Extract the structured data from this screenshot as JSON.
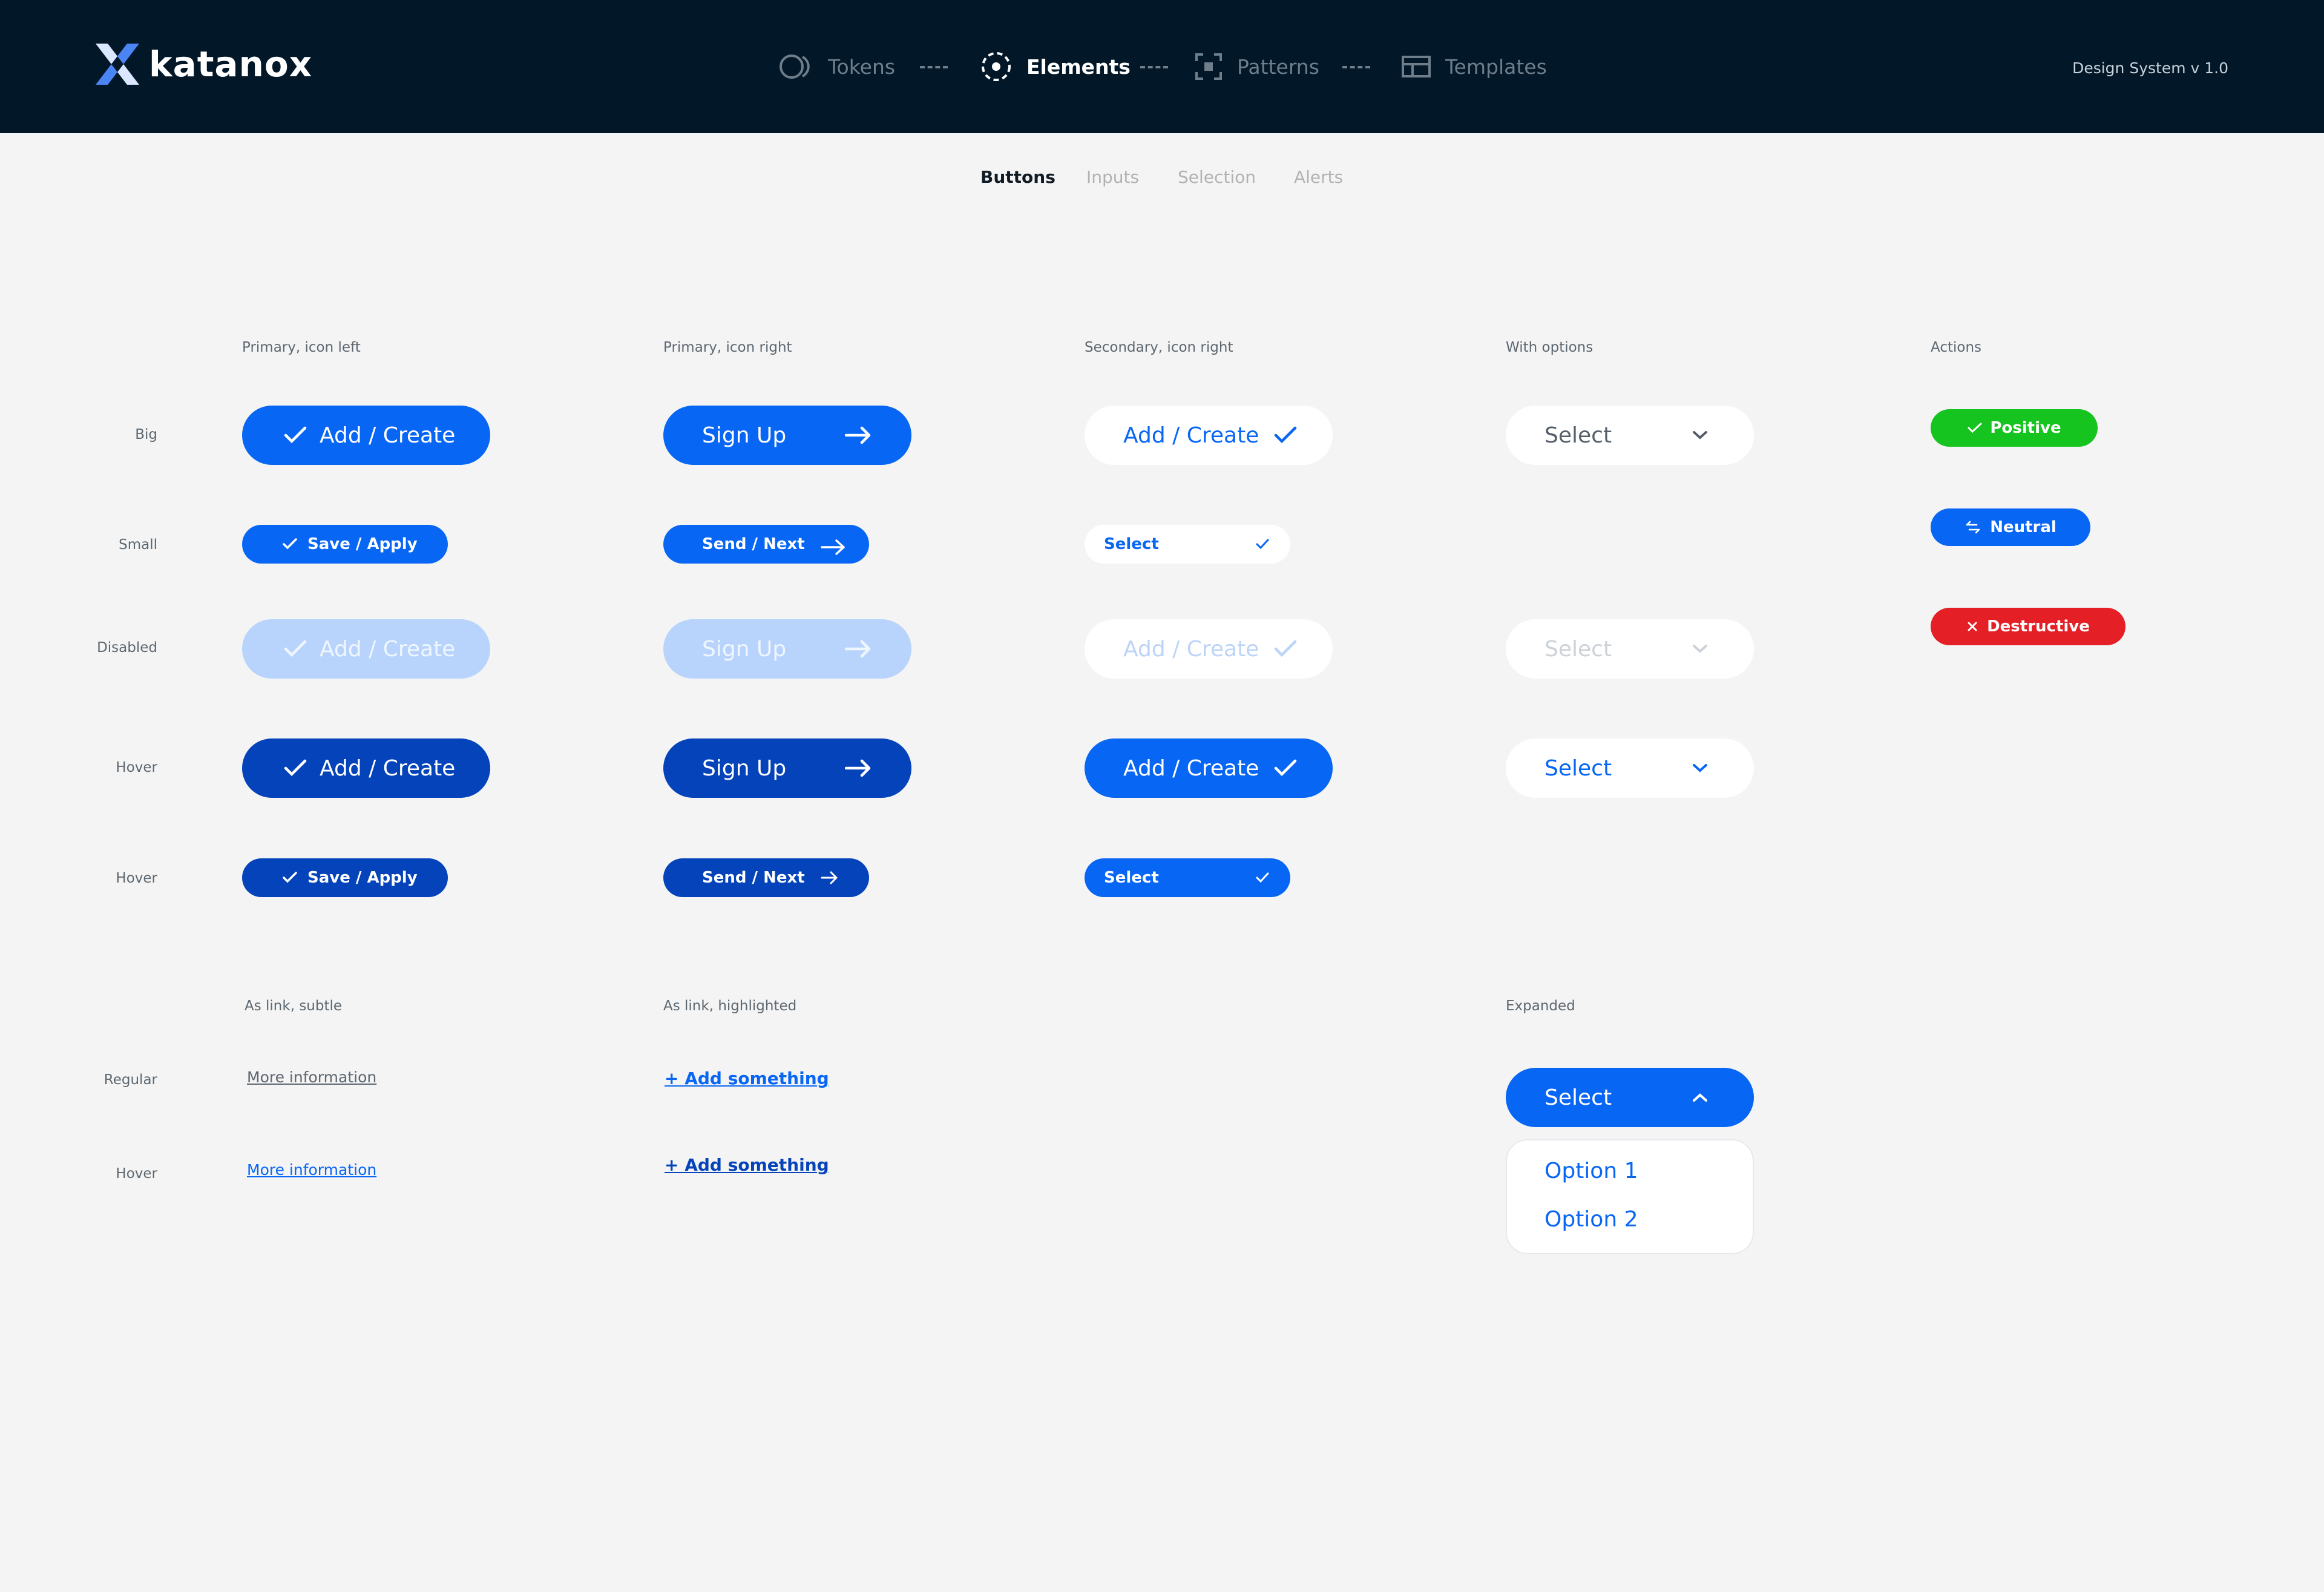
{
  "header": {
    "brand": "katanox",
    "version": "Design System v 1.0",
    "nav": [
      {
        "label": "Tokens"
      },
      {
        "label": "Elements"
      },
      {
        "label": "Patterns"
      },
      {
        "label": "Templates"
      }
    ]
  },
  "subnav": [
    "Buttons",
    "Inputs",
    "Selection",
    "Alerts"
  ],
  "columns": {
    "c1": "Primary, icon left",
    "c2": "Primary, icon right",
    "c3": "Secondary, icon right",
    "c4": "With options",
    "c5": "Actions"
  },
  "rows": {
    "big": "Big",
    "small": "Small",
    "disabled": "Disabled",
    "hover1": "Hover",
    "hover2": "Hover"
  },
  "buttons": {
    "add_create": "Add / Create",
    "sign_up": "Sign Up",
    "save_apply": "Save / Apply",
    "send_next": "Send / Next",
    "select": "Select"
  },
  "actions": {
    "positive": "Positive",
    "neutral": "Neutral",
    "destructive": "Destructive"
  },
  "links_section": {
    "col1": "As link, subtle",
    "col2": "As link, highlighted",
    "col4": "Expanded",
    "row_regular": "Regular",
    "row_hover": "Hover",
    "subtle_text": "More information",
    "highlight_text": "+ Add something"
  },
  "dropdown": {
    "options": [
      "Option 1",
      "Option 2"
    ]
  },
  "colors": {
    "header_bg": "#021727",
    "primary": "#0866f4",
    "primary_hover": "#0443b9",
    "primary_disabled": "#b8d4fd",
    "positive": "#15c41f",
    "destructive": "#e41f25",
    "page_bg": "#f4f4f4"
  }
}
